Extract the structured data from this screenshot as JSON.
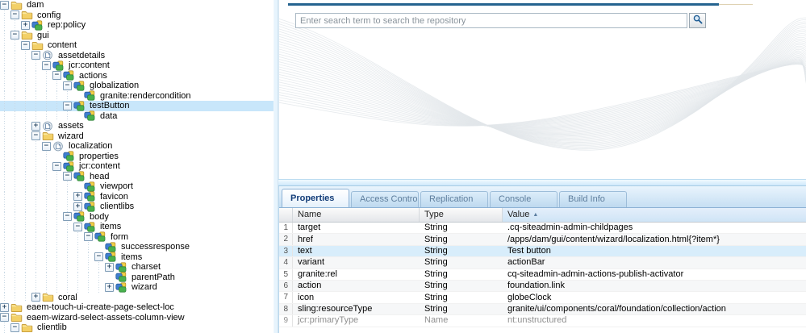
{
  "tree": {
    "items": [
      {
        "label": "dam",
        "icon": "folder",
        "expander": "minus",
        "level": 0
      },
      {
        "label": "config",
        "icon": "folder",
        "expander": "minus",
        "level": 1
      },
      {
        "label": "rep:policy",
        "icon": "node",
        "expander": "plus",
        "level": 2
      },
      {
        "label": "gui",
        "icon": "folder",
        "expander": "minus",
        "level": 1
      },
      {
        "label": "content",
        "icon": "folder",
        "expander": "minus",
        "level": 2
      },
      {
        "label": "assetdetails",
        "icon": "page",
        "expander": "minus",
        "level": 3
      },
      {
        "label": "jcr:content",
        "icon": "node",
        "expander": "minus",
        "level": 4
      },
      {
        "label": "actions",
        "icon": "node",
        "expander": "minus",
        "level": 5
      },
      {
        "label": "globalization",
        "icon": "node",
        "expander": "minus",
        "level": 6
      },
      {
        "label": "granite:rendercondition",
        "icon": "node",
        "expander": "none",
        "level": 7
      },
      {
        "label": "testButton",
        "icon": "node",
        "expander": "minus",
        "level": 6,
        "selected": true
      },
      {
        "label": "data",
        "icon": "node",
        "expander": "none",
        "level": 7
      },
      {
        "label": "assets",
        "icon": "page",
        "expander": "plus",
        "level": 3
      },
      {
        "label": "wizard",
        "icon": "folder",
        "expander": "minus",
        "level": 3
      },
      {
        "label": "localization",
        "icon": "page",
        "expander": "minus",
        "level": 4
      },
      {
        "label": "properties",
        "icon": "node",
        "expander": "none",
        "level": 5
      },
      {
        "label": "jcr:content",
        "icon": "node",
        "expander": "minus",
        "level": 5
      },
      {
        "label": "head",
        "icon": "node",
        "expander": "minus",
        "level": 6
      },
      {
        "label": "viewport",
        "icon": "node",
        "expander": "none",
        "level": 7
      },
      {
        "label": "favicon",
        "icon": "node",
        "expander": "plus",
        "level": 7
      },
      {
        "label": "clientlibs",
        "icon": "node",
        "expander": "plus",
        "level": 7
      },
      {
        "label": "body",
        "icon": "node",
        "expander": "minus",
        "level": 6
      },
      {
        "label": "items",
        "icon": "node",
        "expander": "minus",
        "level": 7
      },
      {
        "label": "form",
        "icon": "node",
        "expander": "minus",
        "level": 8
      },
      {
        "label": "successresponse",
        "icon": "node",
        "expander": "none",
        "level": 9
      },
      {
        "label": "items",
        "icon": "node",
        "expander": "minus",
        "level": 9
      },
      {
        "label": "charset",
        "icon": "node",
        "expander": "plus",
        "level": 10
      },
      {
        "label": "parentPath",
        "icon": "node",
        "expander": "none",
        "level": 10
      },
      {
        "label": "wizard",
        "icon": "node",
        "expander": "plus",
        "level": 10
      },
      {
        "label": "coral",
        "icon": "folder",
        "expander": "plus",
        "level": 3
      },
      {
        "label": "eaem-touch-ui-create-page-select-loc",
        "icon": "folder",
        "expander": "plus",
        "level": 0
      },
      {
        "label": "eaem-wizard-select-assets-column-view",
        "icon": "folder",
        "expander": "minus",
        "level": 0
      },
      {
        "label": "clientlib",
        "icon": "folder",
        "expander": "minus",
        "level": 1
      }
    ]
  },
  "search": {
    "placeholder": "Enter search term to search the repository"
  },
  "glyphs": {
    "expander_expanded": "−",
    "expander_collapsed": "+",
    "sort_asc": "▲"
  },
  "panel": {
    "tabs": [
      {
        "label": "Properties",
        "active": true
      },
      {
        "label": "Access Control",
        "active": false
      },
      {
        "label": "Replication",
        "active": false
      },
      {
        "label": "Console",
        "active": false
      },
      {
        "label": "Build Info",
        "active": false
      }
    ],
    "table": {
      "columns": [
        "Name",
        "Type",
        "Value"
      ],
      "sort": {
        "column": "Value",
        "direction": "asc"
      },
      "rows": [
        {
          "n": 1,
          "name": "target",
          "type": "String",
          "value": ".cq-siteadmin-admin-childpages"
        },
        {
          "n": 2,
          "name": "href",
          "type": "String",
          "value": "/apps/dam/gui/content/wizard/localization.html{?item*}"
        },
        {
          "n": 3,
          "name": "text",
          "type": "String",
          "value": "Test button",
          "selected": true
        },
        {
          "n": 4,
          "name": "variant",
          "type": "String",
          "value": "actionBar"
        },
        {
          "n": 5,
          "name": "granite:rel",
          "type": "String",
          "value": "cq-siteadmin-admin-actions-publish-activator"
        },
        {
          "n": 6,
          "name": "action",
          "type": "String",
          "value": "foundation.link"
        },
        {
          "n": 7,
          "name": "icon",
          "type": "String",
          "value": "globeClock"
        },
        {
          "n": 8,
          "name": "sling:resourceType",
          "type": "String",
          "value": "granite/ui/components/coral/foundation/collection/action"
        },
        {
          "n": 9,
          "name": "jcr:primaryType",
          "type": "Name",
          "value": "nt:unstructured",
          "muted": true
        }
      ]
    }
  },
  "colors": {
    "accent_line": "#25638f",
    "tree_selection": "#c8e6fa",
    "row_selection": "#d8edfb",
    "tab_active_text": "#123c78"
  }
}
